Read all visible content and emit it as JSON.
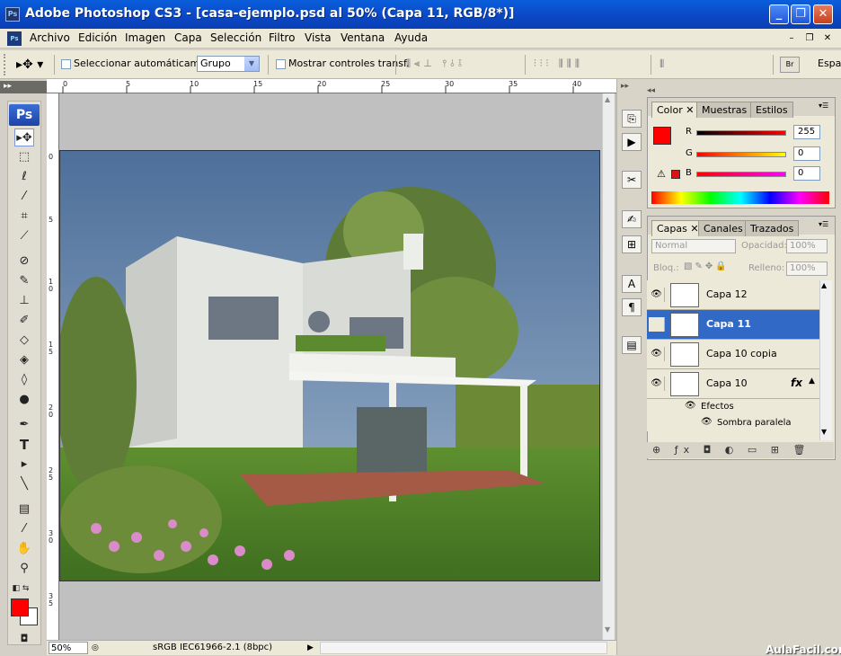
{
  "window": {
    "app_badge": "Ps",
    "title": "Adobe Photoshop CS3 - [casa-ejemplo.psd al 50% (Capa 11, RGB/8*)]",
    "controls": [
      "_",
      "❐",
      "✕"
    ]
  },
  "menubar": {
    "items": [
      "Archivo",
      "Edición",
      "Imagen",
      "Capa",
      "Selección",
      "Filtro",
      "Vista",
      "Ventana",
      "Ayuda"
    ],
    "doc_controls": [
      "–",
      "❐",
      "✕"
    ]
  },
  "options": {
    "auto_select_label": "Seleccionar automáticamente:",
    "auto_select_value": "Grupo",
    "show_transform_label": "Mostrar controles transf.",
    "workspace_label": "Espa"
  },
  "ruler": {
    "top_ticks": [
      "0",
      "5",
      "10",
      "15",
      "20",
      "25",
      "30",
      "35",
      "40"
    ],
    "left_ticks": [
      "0",
      "5",
      "1\n0",
      "1\n5",
      "2\n0",
      "2\n5",
      "3\n0",
      "3\n5"
    ]
  },
  "toolbox": {
    "logo": "Ps",
    "tools": [
      "move",
      "marquee",
      "lasso",
      "magic-wand",
      "crop",
      "slice",
      "healing",
      "brush",
      "clone-stamp",
      "history-brush",
      "eraser",
      "gradient",
      "blur",
      "dodge",
      "pen",
      "text",
      "path-selection",
      "line",
      "notes",
      "eyedropper",
      "hand",
      "zoom"
    ],
    "fg_color": "#ff0000",
    "bg_color": "#ffffff"
  },
  "status": {
    "zoom": "50%",
    "profile": "sRGB IEC61966-2.1 (8bpc)"
  },
  "color_panel": {
    "tabs": [
      "Color",
      "Muestras",
      "Estilos"
    ],
    "channels": [
      {
        "label": "R",
        "value": "255"
      },
      {
        "label": "G",
        "value": "0"
      },
      {
        "label": "B",
        "value": "0"
      }
    ],
    "current_color": "#ff0000"
  },
  "layers_panel": {
    "tabs": [
      "Capas",
      "Canales",
      "Trazados"
    ],
    "blend_mode": "Normal",
    "opacity_label": "Opacidad:",
    "opacity_value": "100%",
    "lock_label": "Bloq.:",
    "fill_label": "Relleno:",
    "fill_value": "100%",
    "layers": [
      {
        "name": "Capa 12",
        "visible": true,
        "selected": false
      },
      {
        "name": "Capa 11",
        "visible": false,
        "selected": true
      },
      {
        "name": "Capa 10 copia",
        "visible": true,
        "selected": false
      },
      {
        "name": "Capa 10",
        "visible": true,
        "selected": false
      }
    ],
    "effects_label": "Efectos",
    "effect_item": "Sombra paralela",
    "fx_label": "fx"
  },
  "watermark": "AulaFacil.com"
}
